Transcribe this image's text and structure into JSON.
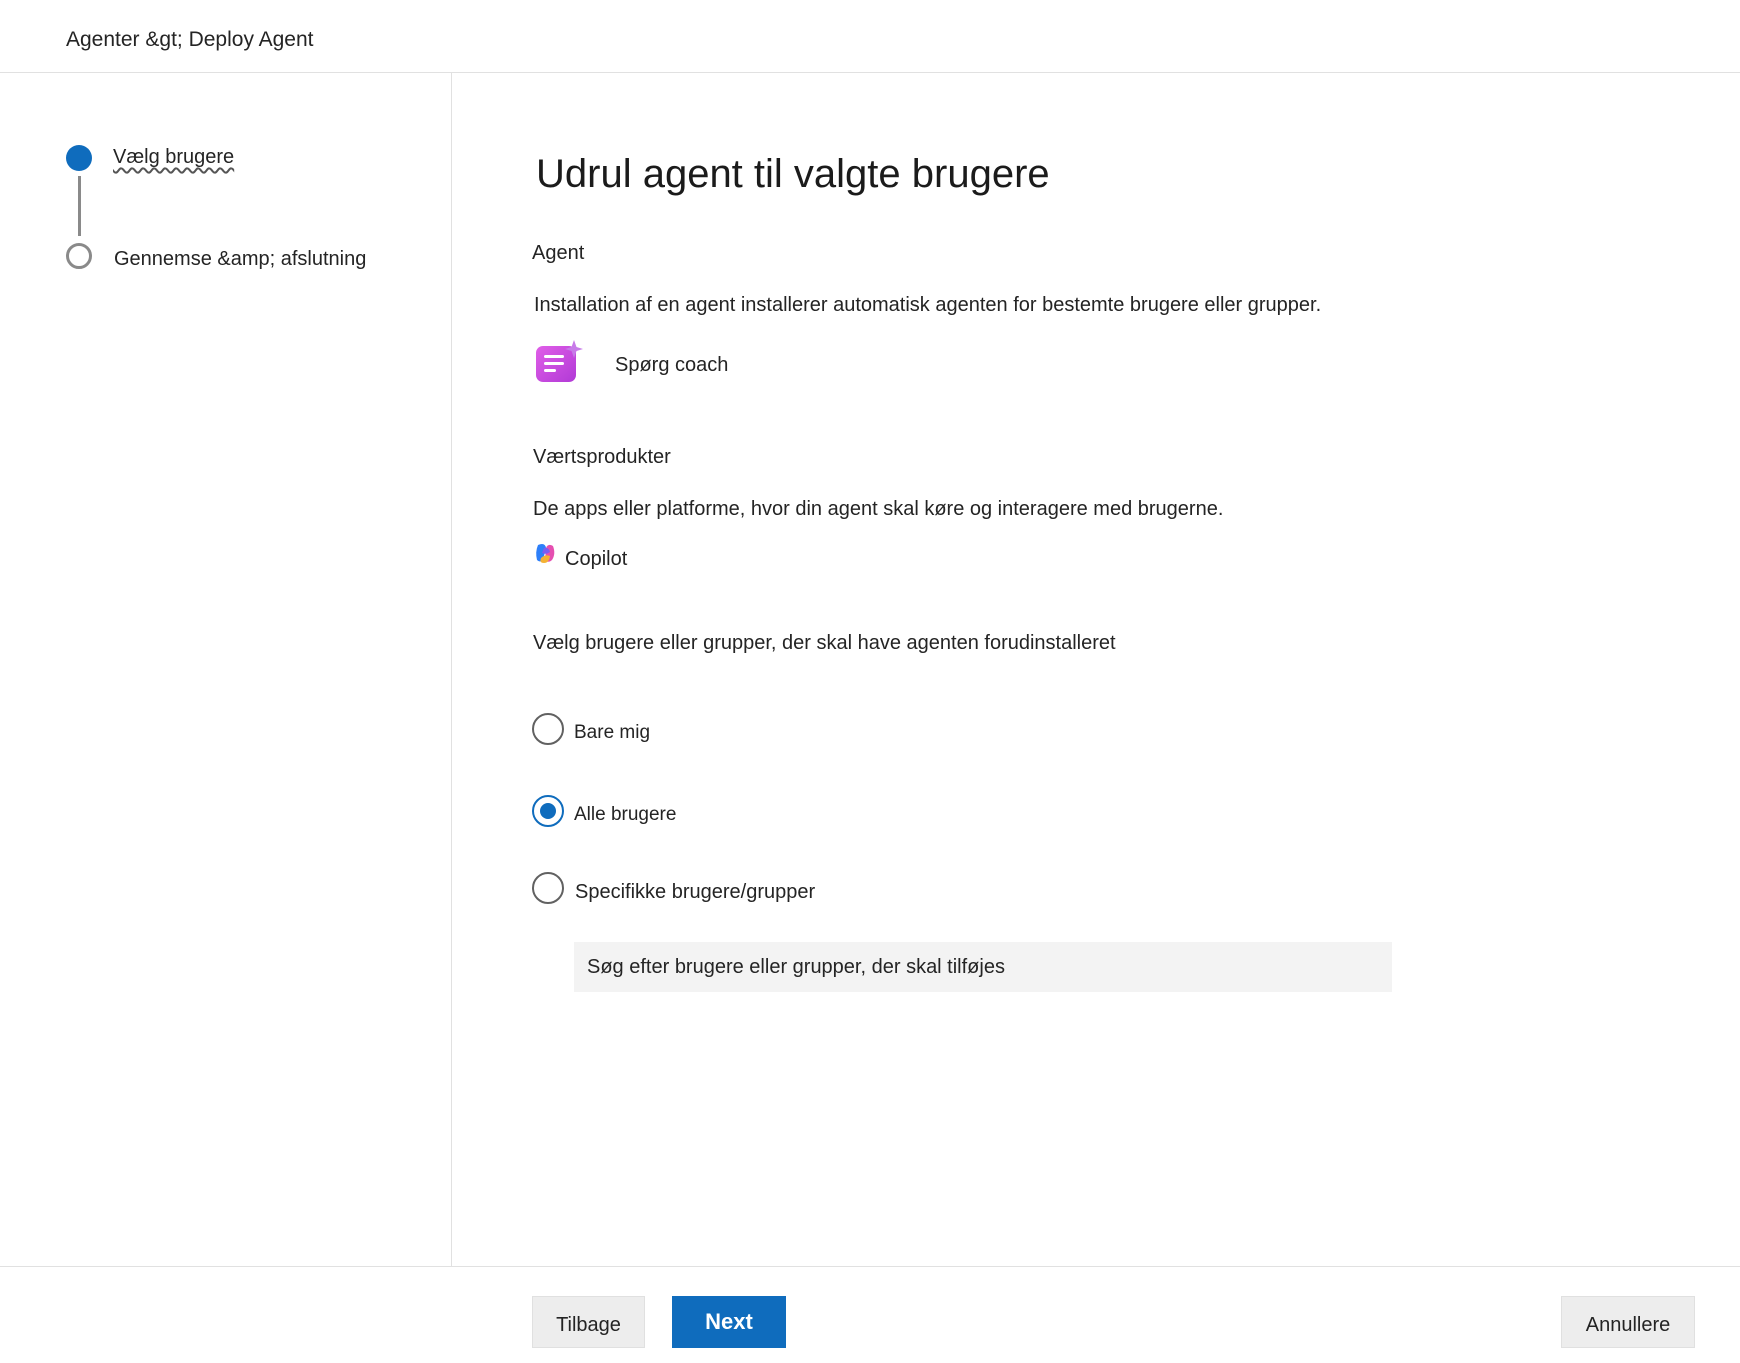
{
  "header": {
    "breadcrumb": "Agenter &gt; Deploy Agent"
  },
  "steps": [
    {
      "label": "Vælg brugere",
      "state": "active"
    },
    {
      "label": "Gennemse &amp; afslutning",
      "state": "inactive"
    }
  ],
  "main": {
    "title": "Udrul agent til valgte brugere",
    "agent_section": {
      "label": "Agent",
      "description": "Installation af en agent installerer automatisk agenten for bestemte brugere eller grupper.",
      "agent_name": "Spørg coach",
      "icon": "agent-app-icon"
    },
    "host_section": {
      "label": "Værtsprodukter",
      "description": "De apps eller platforme, hvor din agent skal køre og interagere med brugerne.",
      "product_name": "Copilot",
      "icon": "copilot-icon"
    },
    "users_section": {
      "label": "Vælg brugere eller grupper, der skal have agenten forudinstalleret",
      "options": [
        {
          "label": "Bare mig",
          "checked": false
        },
        {
          "label": "Alle brugere",
          "checked": true
        },
        {
          "label": "Specifikke brugere/grupper",
          "checked": false
        }
      ],
      "search_placeholder": "Søg efter brugere eller grupper, der skal tilføjes"
    }
  },
  "footer": {
    "back_label": "Tilbage",
    "next_label": "Next",
    "cancel_label": "Annullere"
  },
  "colors": {
    "accent": "#0f6cbd",
    "border": "#e1e1e1",
    "input_bg": "#f3f3f3",
    "button_bg": "#ededed"
  }
}
